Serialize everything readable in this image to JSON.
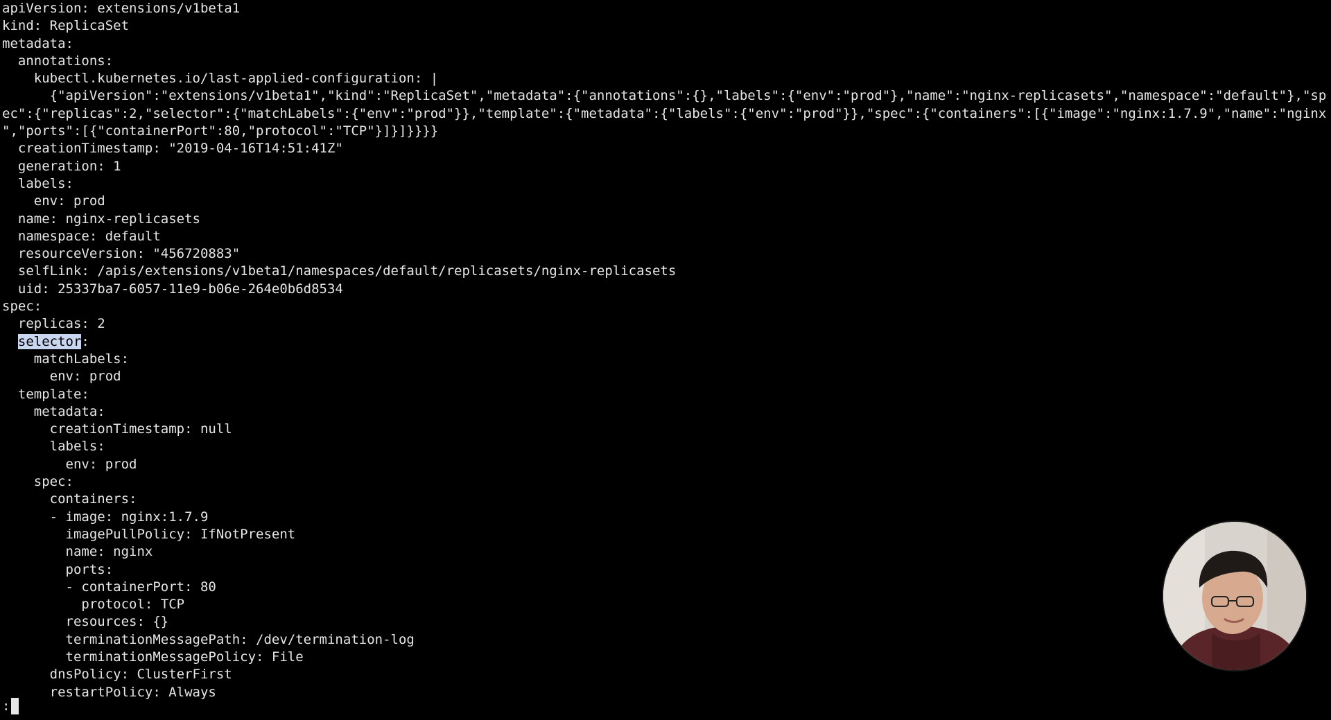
{
  "terminal": {
    "lines": [
      "apiVersion: extensions/v1beta1",
      "kind: ReplicaSet",
      "metadata:",
      "  annotations:",
      "    kubectl.kubernetes.io/last-applied-configuration: |",
      "      {\"apiVersion\":\"extensions/v1beta1\",\"kind\":\"ReplicaSet\",\"metadata\":{\"annotations\":{},\"labels\":{\"env\":\"prod\"},\"name\":\"nginx-replicasets\",\"namespace\":\"default\"},\"sp",
      "ec\":{\"replicas\":2,\"selector\":{\"matchLabels\":{\"env\":\"prod\"}},\"template\":{\"metadata\":{\"labels\":{\"env\":\"prod\"}},\"spec\":{\"containers\":[{\"image\":\"nginx:1.7.9\",\"name\":\"nginx",
      "\",\"ports\":[{\"containerPort\":80,\"protocol\":\"TCP\"}]}]}}}}",
      "  creationTimestamp: \"2019-04-16T14:51:41Z\"",
      "  generation: 1",
      "  labels:",
      "    env: prod",
      "  name: nginx-replicasets",
      "  namespace: default",
      "  resourceVersion: \"456720883\"",
      "  selfLink: /apis/extensions/v1beta1/namespaces/default/replicasets/nginx-replicasets",
      "  uid: 25337ba7-6057-11e9-b06e-264e0b6d8534",
      "spec:",
      "  replicas: 2",
      "  selector:",
      "    matchLabels:",
      "      env: prod",
      "  template:",
      "    metadata:",
      "      creationTimestamp: null",
      "      labels:",
      "        env: prod",
      "    spec:",
      "      containers:",
      "      - image: nginx:1.7.9",
      "        imagePullPolicy: IfNotPresent",
      "        name: nginx",
      "        ports:",
      "        - containerPort: 80",
      "          protocol: TCP",
      "        resources: {}",
      "        terminationMessagePath: /dev/termination-log",
      "        terminationMessagePolicy: File",
      "      dnsPolicy: ClusterFirst",
      "      restartPolicy: Always"
    ],
    "highlight": {
      "line_index": 19,
      "indent": "  ",
      "text": "selector",
      "rest": ":"
    },
    "prompt": ":"
  },
  "webcam": {
    "icon": "person-webcam-icon"
  },
  "colors": {
    "background": "#000000",
    "text": "#e6e6e6",
    "highlight": "#c9d6f0"
  }
}
